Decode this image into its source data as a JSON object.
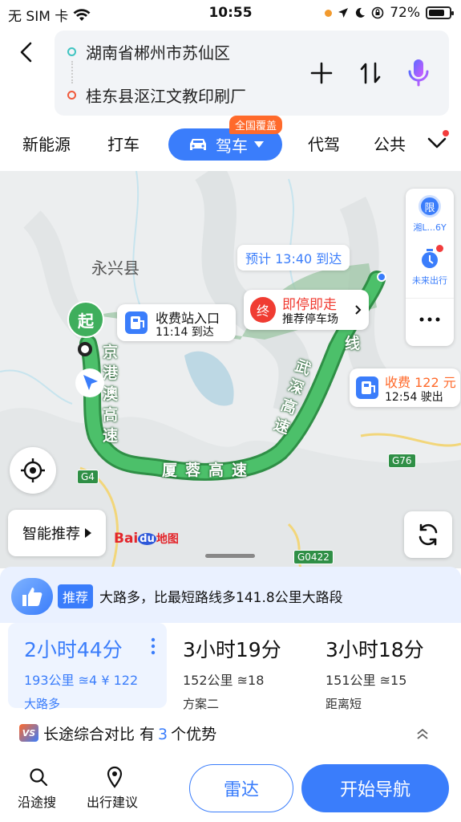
{
  "status": {
    "carrier": "无 SIM 卡",
    "time": "10:55",
    "battery": "72%"
  },
  "search": {
    "origin": "湖南省郴州市苏仙区",
    "destination": "桂东县沤江文教印刷厂"
  },
  "tabs": {
    "new_energy": "新能源",
    "taxi": "打车",
    "drive": "驾车",
    "designated": "代驾",
    "public": "公共",
    "badge": "全国覆盖"
  },
  "map": {
    "county": "永兴县",
    "start_label": "起",
    "eta": "预计 13:40 到达",
    "tollgate_title": "收费站入口",
    "tollgate_time": "11:14 到达",
    "park_title": "即停即走",
    "park_sub": "推荐停车场",
    "park_mark": "终",
    "toll_title": "收费 122 元",
    "toll_time": "12:54 驶出",
    "road1": "京港澳高速",
    "road2": "厦蓉高速",
    "road3": "武深高速",
    "road3b": "线",
    "g4": "G4",
    "g76": "G76",
    "g0422": "G0422",
    "restrict_label": "湘L...6Y",
    "restrict_char": "限",
    "future_label": "未来出行",
    "smart": "智能推荐",
    "logo_a": "Bai",
    "logo_b": "du",
    "logo_c": "地图"
  },
  "recommend": {
    "tag": "推荐",
    "text": "大路多，比最短路线多141.8公里大路段"
  },
  "plans": [
    {
      "time": "2小时44分",
      "dist": "193公里",
      "lights": "4",
      "toll": "¥ 122",
      "tag": "大路多"
    },
    {
      "time": "3小时19分",
      "dist": "152公里",
      "lights": "18",
      "tag": "方案二"
    },
    {
      "time": "3小时18分",
      "dist": "151公里",
      "lights": "15",
      "tag": "距离短"
    }
  ],
  "compare": {
    "text": "长途综合对比 有",
    "num": "3",
    "tail": "个优势",
    "logo": "VS"
  },
  "footer": {
    "along": "沿途搜",
    "advice": "出行建议",
    "radar": "雷达",
    "start": "开始导航"
  },
  "colors": {
    "accent": "#3a7dfb",
    "route": "#3fae5c",
    "toll": "#ff6a2b"
  }
}
